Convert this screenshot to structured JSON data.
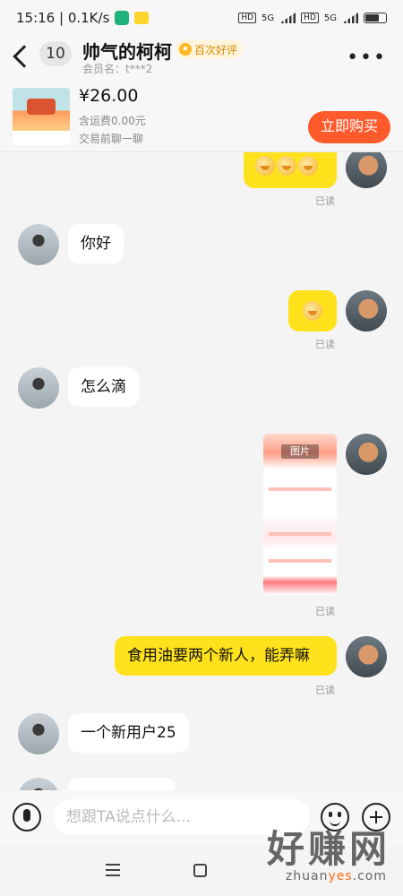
{
  "status": {
    "time_speed": "15:16 | 0.1K/s",
    "sim1": "HD",
    "sim1_net": "5G",
    "sim2": "HD",
    "sim2_net": "5G"
  },
  "header": {
    "unread_count": "10",
    "title": "帅气的柯柯",
    "badge": "百次好评",
    "member": "会员名：t***2"
  },
  "product": {
    "price": "¥26.00",
    "shipping": "含运费0.00元",
    "chat_first": "交易前聊一聊",
    "buy_label": "立即购买"
  },
  "messages": {
    "read_label": "已读",
    "m1": "你好",
    "m2": "怎么滴",
    "image_tag": "图片",
    "m3": "食用油要两个新人，能弄嘛",
    "m4": "一个新用户25"
  },
  "input": {
    "placeholder": "想跟TA说点什么..."
  },
  "watermark": {
    "big": "好赚网",
    "small_a": "zhuan",
    "small_b": "yes",
    "small_c": ".com"
  },
  "colors": {
    "accent": "#ff5a2c",
    "bubble_self": "#ffe21b"
  }
}
